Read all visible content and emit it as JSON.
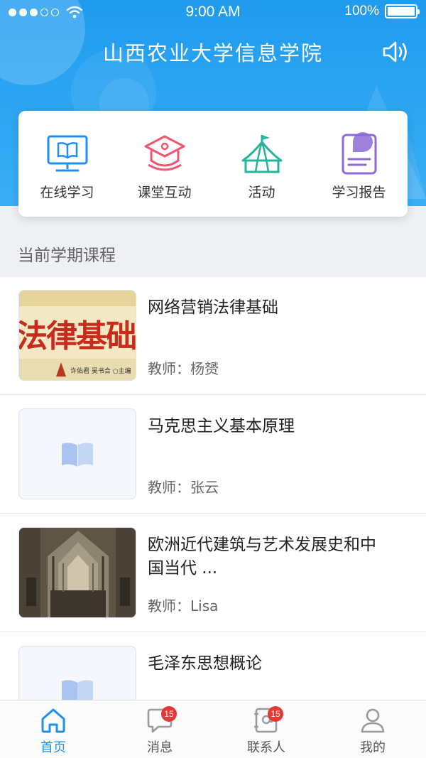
{
  "status_bar": {
    "time": "9:00 AM",
    "battery": "100%"
  },
  "header": {
    "title": "山西农业大学信息学院",
    "speaker_icon": "speaker-icon"
  },
  "quick_menu": [
    {
      "label": "在线学习",
      "icon": "monitor-book-icon",
      "color": "#1f8ff0"
    },
    {
      "label": "课堂互动",
      "icon": "graduation-cap-icon",
      "color": "#f2546e"
    },
    {
      "label": "活动",
      "icon": "tent-icon",
      "color": "#27b39a"
    },
    {
      "label": "学习报告",
      "icon": "report-icon",
      "color": "#8c6bd6"
    }
  ],
  "section": {
    "title": "当前学期课程"
  },
  "courses": [
    {
      "name": "网络营销法律基础",
      "teacher": "教师：杨赟",
      "cover": "law-book-cover",
      "cover_text": "法律基础",
      "cover_caption": "许佑君 吴书合 ○主编"
    },
    {
      "name": "马克思主义基本原理",
      "teacher": "教师：张云",
      "cover": "placeholder-book"
    },
    {
      "name": "欧洲近代建筑与艺术发展史和中国当代 ...",
      "teacher": "教师：Lisa",
      "cover": "cathedral-photo"
    },
    {
      "name": "毛泽东思想概论",
      "teacher": "",
      "cover": "placeholder-book"
    }
  ],
  "tabs": [
    {
      "label": "首页",
      "icon": "home-icon",
      "active": true
    },
    {
      "label": "消息",
      "icon": "message-icon",
      "badge": "15"
    },
    {
      "label": "联系人",
      "icon": "contacts-icon",
      "badge": "15"
    },
    {
      "label": "我的",
      "icon": "profile-icon"
    }
  ],
  "colors": {
    "accent": "#1f8ff0",
    "header": "#2fa7f2",
    "badge": "#e53935"
  }
}
